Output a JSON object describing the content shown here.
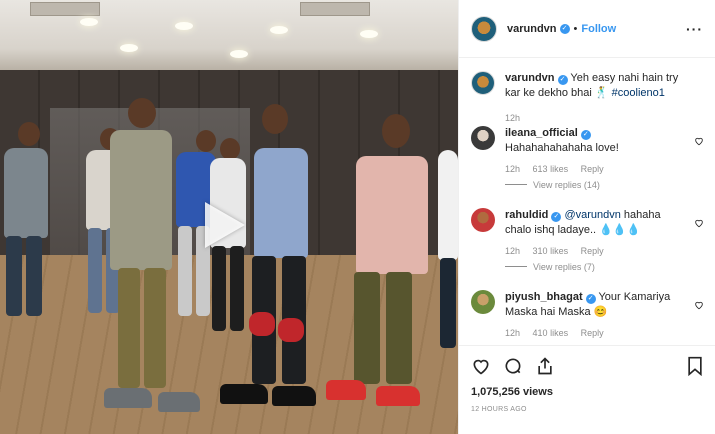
{
  "header": {
    "username": "varundvn",
    "follow_label": "Follow",
    "dot": "•",
    "more_label": "···"
  },
  "caption": {
    "username": "varundvn",
    "text": "Yeh easy nahi hain try kar ke dekho bhai 🕺",
    "hashtag": "#coolieno1",
    "age": "12h"
  },
  "comments": [
    {
      "username": "ileana_official",
      "verified": true,
      "text": "Hahahahahahaha love!",
      "age": "12h",
      "likes": "613 likes",
      "reply_label": "Reply",
      "view_replies": "View replies (14)"
    },
    {
      "username": "rahuldid",
      "verified": true,
      "mention": "@varundvn",
      "text": " hahaha chalo ishq ladaye.. 💧💧💧",
      "age": "12h",
      "likes": "310 likes",
      "reply_label": "Reply",
      "view_replies": "View replies (7)"
    },
    {
      "username": "piyush_bhagat",
      "verified": true,
      "text": "Your Kamariya Maska hai Maska 😊",
      "age": "12h",
      "likes": "410 likes",
      "reply_label": "Reply"
    }
  ],
  "footer": {
    "views": "1,075,256 views",
    "timestamp": "12 HOURS AGO"
  },
  "colors": {
    "accent": "#3897f0",
    "text": "#262626",
    "muted": "#8e8e8e"
  },
  "icons": [
    "play-icon",
    "verified-icon",
    "more-icon",
    "heart-icon",
    "comment-icon",
    "share-icon",
    "bookmark-icon"
  ]
}
